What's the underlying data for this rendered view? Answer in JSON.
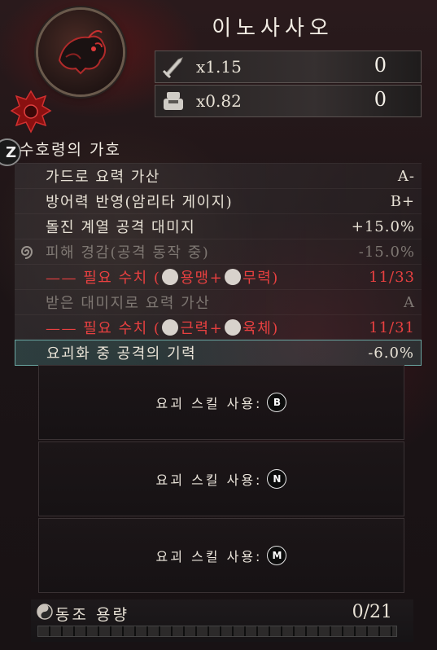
{
  "header": {
    "title": "이노사사오",
    "attack_multiplier": "x1.15",
    "attack_value": "0",
    "defense_multiplier": "x0.82",
    "defense_value": "0"
  },
  "section": {
    "key": "Z",
    "title": "수호령의 가호"
  },
  "rows": [
    {
      "label": "가드로 요력 가산",
      "value": "A-"
    },
    {
      "label": "방어력 반영(암리타 게이지)",
      "value": "B+"
    },
    {
      "label": "돌진 계열 공격 대미지",
      "value": "+15.0%"
    },
    {
      "label": "피해 경감(공격 동작 중)",
      "value": "-15.0%"
    },
    {
      "label_prefix": "—— 필요 수치 (",
      "stat1": "용맹",
      "plus": "+",
      "stat2": "무력",
      "label_suffix": ")",
      "value": "11/33"
    },
    {
      "label": "받은 대미지로 요력 가산",
      "value": "A"
    },
    {
      "label_prefix": "—— 필요 수치 (",
      "stat1": "근력",
      "plus": "+",
      "stat2": "육체",
      "label_suffix": ")",
      "value": "11/31"
    },
    {
      "label": "요괴화 중 공격의 기력",
      "value": "-6.0%"
    }
  ],
  "skills": [
    {
      "label": "요괴 스킬 사용:",
      "key": "B"
    },
    {
      "label": "요괴 스킬 사용:",
      "key": "N"
    },
    {
      "label": "요괴 스킬 사용:",
      "key": "M"
    }
  ],
  "sync": {
    "label": "동조 용량",
    "count": "0/21",
    "fraction": 0
  },
  "colors": {
    "requirement": "#e84040",
    "dimmed": "#7e7772",
    "highlight": "#6aa6a2"
  },
  "icons": {
    "emblem": "boar-spirit-emblem",
    "crest": "rank-crest-icon",
    "attack": "sword-icon",
    "defense": "armor-icon",
    "damage_reduction": "spiral-icon",
    "sync": "yin-yang-icon"
  }
}
